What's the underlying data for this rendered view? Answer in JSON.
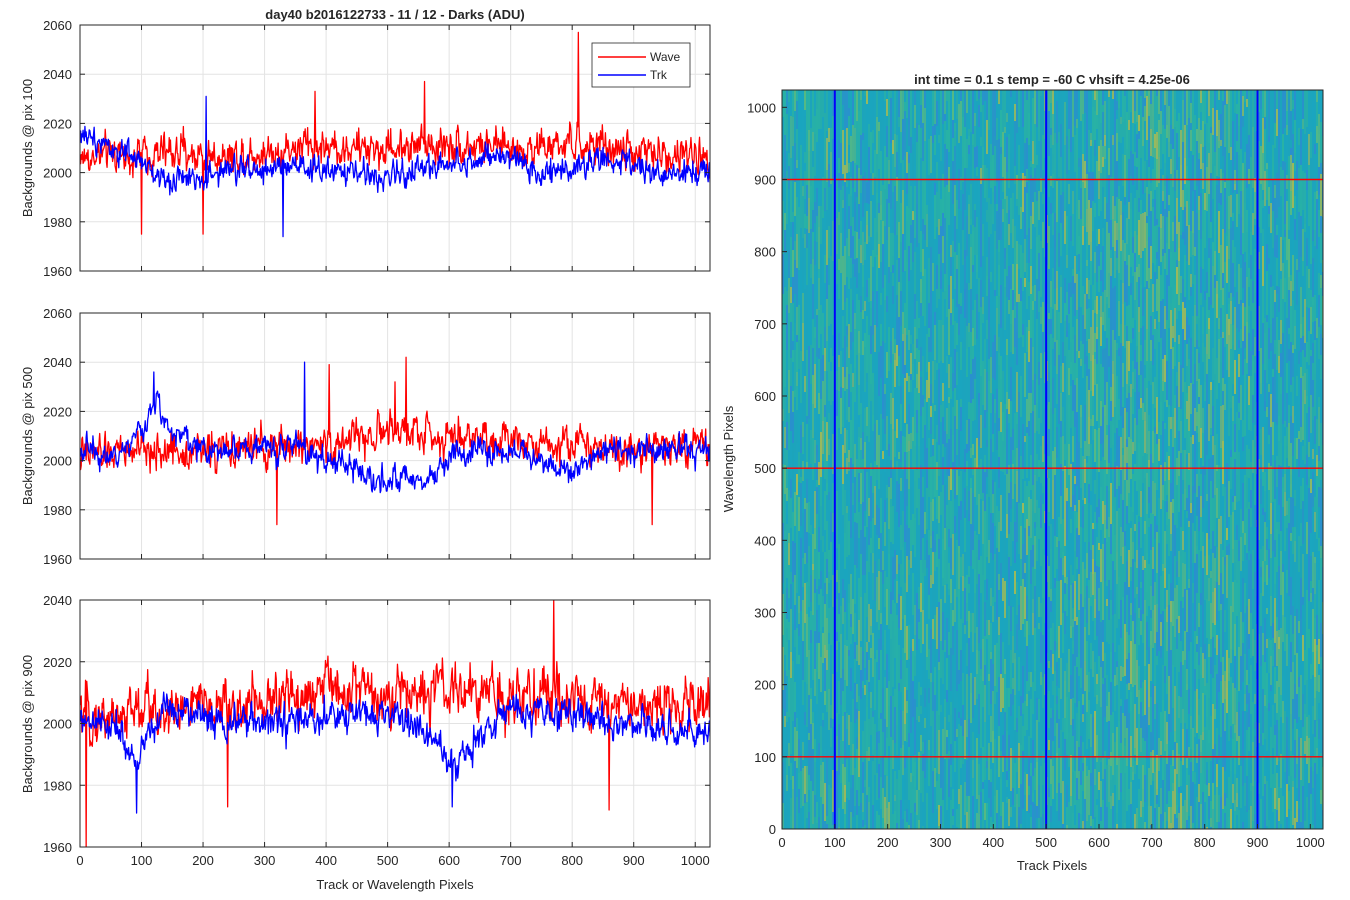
{
  "chart_data": [
    {
      "type": "line",
      "title": "day40 b2016122733 - 11 / 12 - Darks (ADU)",
      "ylabel": "Backgrounds @ pix 100",
      "xlabel": "",
      "xlim": [
        0,
        1024
      ],
      "ylim": [
        1960,
        2060
      ],
      "xticks": [
        0,
        100,
        200,
        300,
        400,
        500,
        600,
        700,
        800,
        900,
        1000
      ],
      "yticks": [
        "1960",
        "1980",
        "2000",
        "2020",
        "2040",
        "2060"
      ],
      "grid": true,
      "legend": {
        "placement": "top-right",
        "entries": [
          "Wave",
          "Trk"
        ]
      },
      "series": [
        {
          "name": "Wave",
          "color": "#ff0000",
          "mean": 2005,
          "std": 7,
          "min": 1975,
          "max": 2057,
          "profile": [
            [
              0,
              4
            ],
            [
              120,
              6
            ],
            [
              250,
              5
            ],
            [
              380,
              9
            ],
            [
              480,
              7
            ],
            [
              560,
              10
            ],
            [
              700,
              8
            ],
            [
              820,
              9
            ],
            [
              950,
              5
            ],
            [
              1024,
              5
            ]
          ],
          "spikes": [
            [
              810,
              2057
            ],
            [
              560,
              2037
            ],
            [
              382,
              2033
            ],
            [
              100,
              1975
            ],
            [
              200,
              1975
            ]
          ]
        },
        {
          "name": "Trk",
          "color": "#0000ff",
          "mean": 2002,
          "std": 5,
          "min": 1974,
          "max": 2031,
          "profile": [
            [
              0,
              14
            ],
            [
              40,
              10
            ],
            [
              120,
              -2
            ],
            [
              150,
              -5
            ],
            [
              280,
              0
            ],
            [
              350,
              -1
            ],
            [
              450,
              -2
            ],
            [
              500,
              -4
            ],
            [
              600,
              2
            ],
            [
              700,
              4
            ],
            [
              750,
              -2
            ],
            [
              850,
              3
            ],
            [
              950,
              -3
            ],
            [
              1024,
              0
            ]
          ],
          "spikes": [
            [
              205,
              2031
            ],
            [
              330,
              1974
            ]
          ]
        }
      ]
    },
    {
      "type": "line",
      "title": "",
      "ylabel": "Backgrounds @ pix 500",
      "xlabel": "",
      "xlim": [
        0,
        1024
      ],
      "ylim": [
        1960,
        2060
      ],
      "xticks": [
        0,
        100,
        200,
        300,
        400,
        500,
        600,
        700,
        800,
        900,
        1000
      ],
      "yticks": [
        "1960",
        "1980",
        "2000",
        "2020",
        "2040",
        "2060"
      ],
      "grid": true,
      "series": [
        {
          "name": "Wave",
          "color": "#ff0000",
          "mean": 2007,
          "std": 7,
          "min": 1974,
          "max": 2042,
          "profile": [
            [
              0,
              0
            ],
            [
              120,
              2
            ],
            [
              250,
              2
            ],
            [
              400,
              5
            ],
            [
              520,
              10
            ],
            [
              600,
              8
            ],
            [
              720,
              7
            ],
            [
              850,
              4
            ],
            [
              1024,
              3
            ]
          ],
          "spikes": [
            [
              530,
              2042
            ],
            [
              512,
              2032
            ],
            [
              405,
              2039
            ],
            [
              320,
              1974
            ],
            [
              930,
              1974
            ]
          ]
        },
        {
          "name": "Trk",
          "color": "#0000ff",
          "mean": 2002,
          "std": 5,
          "min": 1979,
          "max": 2040,
          "profile": [
            [
              0,
              3
            ],
            [
              60,
              0
            ],
            [
              100,
              10
            ],
            [
              125,
              22
            ],
            [
              150,
              10
            ],
            [
              200,
              2
            ],
            [
              350,
              4
            ],
            [
              420,
              -4
            ],
            [
              500,
              -10
            ],
            [
              560,
              -12
            ],
            [
              610,
              1
            ],
            [
              700,
              2
            ],
            [
              780,
              -4
            ],
            [
              800,
              -6
            ],
            [
              850,
              2
            ],
            [
              1024,
              3
            ]
          ],
          "spikes": [
            [
              365,
              2040
            ],
            [
              120,
              2036
            ]
          ]
        }
      ]
    },
    {
      "type": "line",
      "title": "",
      "ylabel": "Backgrounds @ pix 900",
      "xlabel": "Track or Wavelength Pixels",
      "xlim": [
        0,
        1024
      ],
      "ylim": [
        1960,
        2040
      ],
      "xticks": [
        0,
        100,
        200,
        300,
        400,
        500,
        600,
        700,
        800,
        900,
        1000
      ],
      "yticks": [
        "1960",
        "1980",
        "2000",
        "2020",
        "2040"
      ],
      "grid": true,
      "series": [
        {
          "name": "Wave",
          "color": "#ff0000",
          "mean": 2006,
          "std": 8,
          "min": 1960,
          "max": 2040,
          "profile": [
            [
              0,
              0
            ],
            [
              150,
              3
            ],
            [
              300,
              4
            ],
            [
              400,
              10
            ],
            [
              500,
              8
            ],
            [
              600,
              8
            ],
            [
              700,
              7
            ],
            [
              800,
              6
            ],
            [
              900,
              4
            ],
            [
              1024,
              4
            ]
          ],
          "spikes": [
            [
              10,
              1960
            ],
            [
              770,
              2040
            ],
            [
              240,
              1973
            ],
            [
              860,
              1972
            ]
          ]
        },
        {
          "name": "Trk",
          "color": "#0000ff",
          "mean": 2002,
          "std": 5,
          "min": 1971,
          "max": 2030,
          "profile": [
            [
              0,
              -2
            ],
            [
              60,
              -3
            ],
            [
              90,
              -16
            ],
            [
              110,
              -6
            ],
            [
              140,
              4
            ],
            [
              250,
              -2
            ],
            [
              400,
              -1
            ],
            [
              490,
              2
            ],
            [
              550,
              -3
            ],
            [
              610,
              -16
            ],
            [
              650,
              -5
            ],
            [
              700,
              2
            ],
            [
              900,
              -1
            ],
            [
              1000,
              -6
            ],
            [
              1024,
              -3
            ]
          ],
          "spikes": [
            [
              92,
              1971
            ],
            [
              605,
              1973
            ]
          ]
        }
      ]
    },
    {
      "type": "heatmap",
      "title": "int time = 0.1 s   temp = -60 C   vhsift = 4.25e-06",
      "xlabel": "Track Pixels",
      "ylabel": "Wavelength Pixels",
      "xlim": [
        0,
        1024
      ],
      "ylim": [
        0,
        1024
      ],
      "xticks": [
        0,
        100,
        200,
        300,
        400,
        500,
        600,
        700,
        800,
        900,
        1000
      ],
      "yticks": [
        0,
        100,
        200,
        300,
        400,
        500,
        600,
        700,
        800,
        900,
        1000
      ],
      "colormap": [
        "#2a8fcf",
        "#1aa5bf",
        "#28b2a5",
        "#55b984",
        "#9ab95c"
      ],
      "background_color": "#21a3b7",
      "brighter_band": [
        550,
        850
      ],
      "vertical_markers": {
        "color": "#0000ff",
        "x": [
          100,
          500,
          900
        ]
      },
      "horizontal_markers": {
        "color": "#ff0000",
        "y": [
          100,
          500,
          900
        ]
      }
    }
  ]
}
